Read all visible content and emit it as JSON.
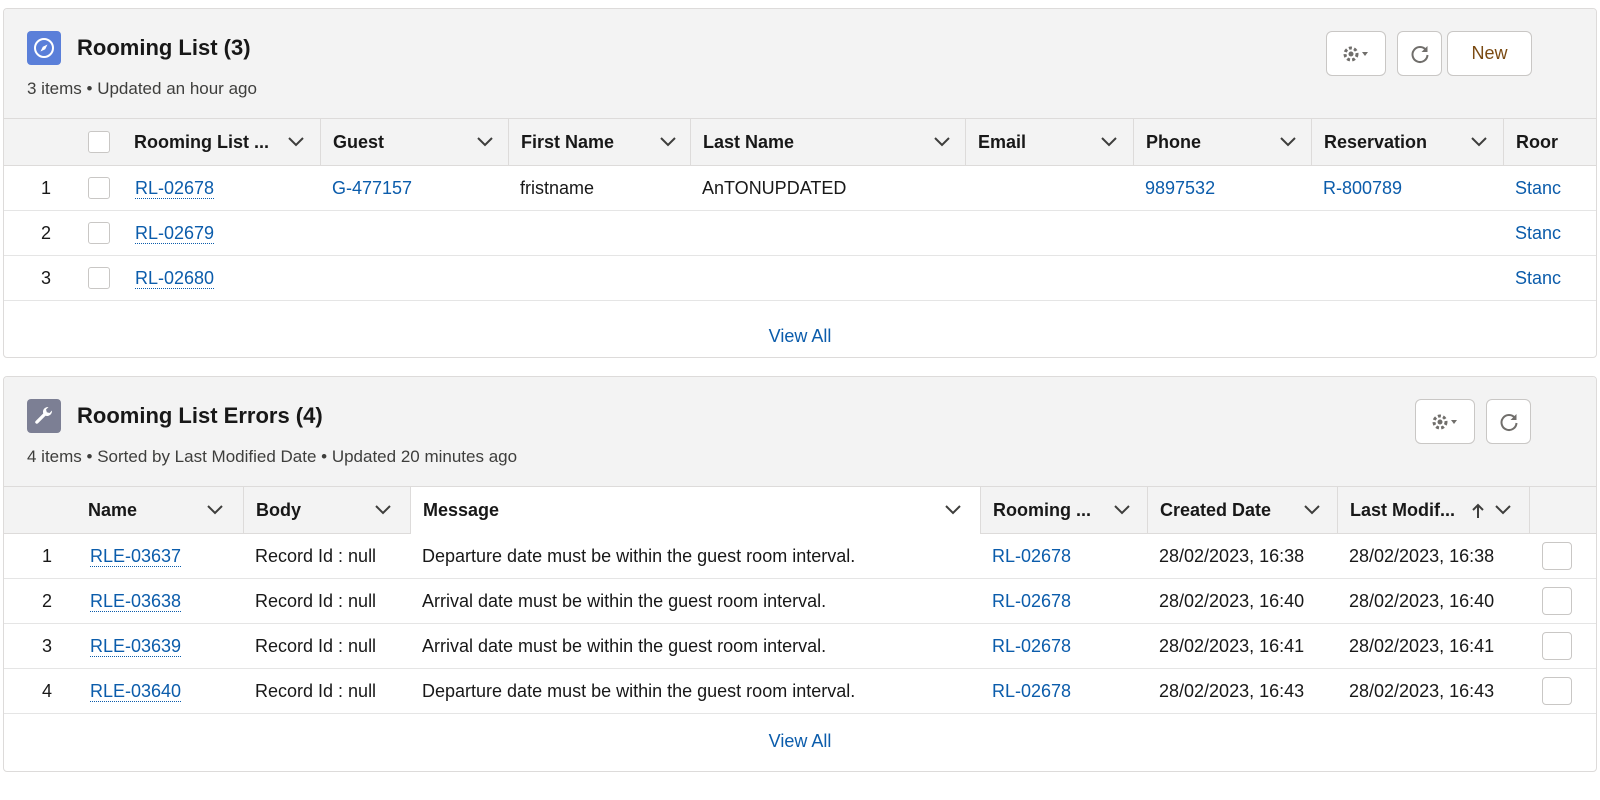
{
  "rooming_list": {
    "title": "Rooming List (3)",
    "subtitle": "3 items • Updated an hour ago",
    "new_label": "New",
    "columns": [
      "Rooming List ...",
      "Guest",
      "First Name",
      "Last Name",
      "Email",
      "Phone",
      "Reservation",
      "Roor"
    ],
    "rows": [
      {
        "num": "1",
        "name": "RL-02678",
        "guest": "G-477157",
        "first": "fristname",
        "last": "AnTONUPDATED",
        "email": "",
        "phone": "9897532",
        "reservation": "R-800789",
        "room": "Stanc"
      },
      {
        "num": "2",
        "name": "RL-02679",
        "guest": "",
        "first": "",
        "last": "",
        "email": "",
        "phone": "",
        "reservation": "",
        "room": "Stanc"
      },
      {
        "num": "3",
        "name": "RL-02680",
        "guest": "",
        "first": "",
        "last": "",
        "email": "",
        "phone": "",
        "reservation": "",
        "room": "Stanc"
      }
    ],
    "view_all": "View All",
    "icon": "compass-icon",
    "icon_color": "#5a7fd9"
  },
  "errors": {
    "title": "Rooming List Errors (4)",
    "subtitle": "4 items • Sorted by Last Modified Date • Updated 20 minutes ago",
    "columns": [
      "Name",
      "Body",
      "Message",
      "Rooming ...",
      "Created Date",
      "Last Modif..."
    ],
    "rows": [
      {
        "num": "1",
        "name": "RLE-03637",
        "body": "Record Id : null",
        "message": "Departure date must be within the guest room interval.",
        "rooming": "RL-02678",
        "created": "28/02/2023, 16:38",
        "modified": "28/02/2023, 16:38"
      },
      {
        "num": "2",
        "name": "RLE-03638",
        "body": "Record Id : null",
        "message": "Arrival date must be within the guest room interval.",
        "rooming": "RL-02678",
        "created": "28/02/2023, 16:40",
        "modified": "28/02/2023, 16:40"
      },
      {
        "num": "3",
        "name": "RLE-03639",
        "body": "Record Id : null",
        "message": "Arrival date must be within the guest room interval.",
        "rooming": "RL-02678",
        "created": "28/02/2023, 16:41",
        "modified": "28/02/2023, 16:41"
      },
      {
        "num": "4",
        "name": "RLE-03640",
        "body": "Record Id : null",
        "message": "Departure date must be within the guest room interval.",
        "rooming": "RL-02678",
        "created": "28/02/2023, 16:43",
        "modified": "28/02/2023, 16:43"
      }
    ],
    "view_all": "View All",
    "icon": "wrench-icon",
    "icon_color": "#7c7f94"
  }
}
